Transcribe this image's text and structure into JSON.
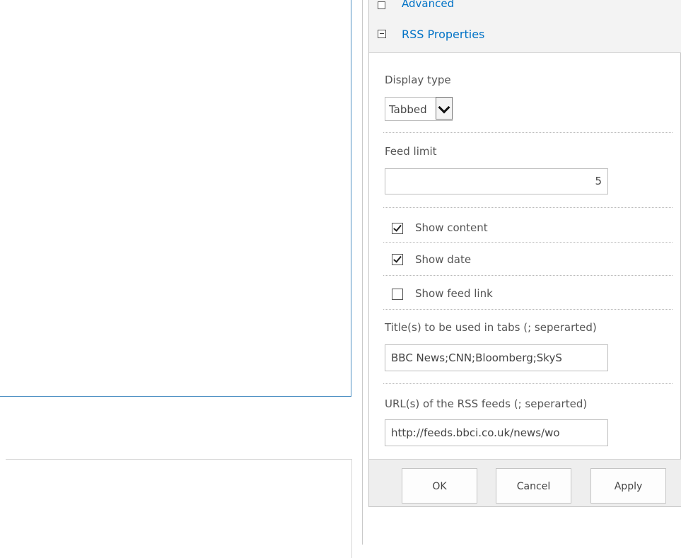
{
  "toolpane": {
    "advanced_section_label": "Advanced",
    "section_title": "RSS Properties",
    "display_type": {
      "label": "Display type",
      "selected": "Tabbed"
    },
    "feed_limit": {
      "label": "Feed limit",
      "value": "5"
    },
    "checkboxes": [
      {
        "label": "Show content",
        "checked": true
      },
      {
        "label": "Show date",
        "checked": true
      },
      {
        "label": "Show feed link",
        "checked": false
      }
    ],
    "titles": {
      "label": "Title(s) to be used in tabs (; seperarted)",
      "value": "BBC News;CNN;Bloomberg;SkyS"
    },
    "urls": {
      "label": "URL(s) of the RSS feeds (; seperarted)",
      "value": "http://feeds.bbci.co.uk/news/wo"
    },
    "buttons": {
      "ok": "OK",
      "cancel": "Cancel",
      "apply": "Apply"
    }
  }
}
